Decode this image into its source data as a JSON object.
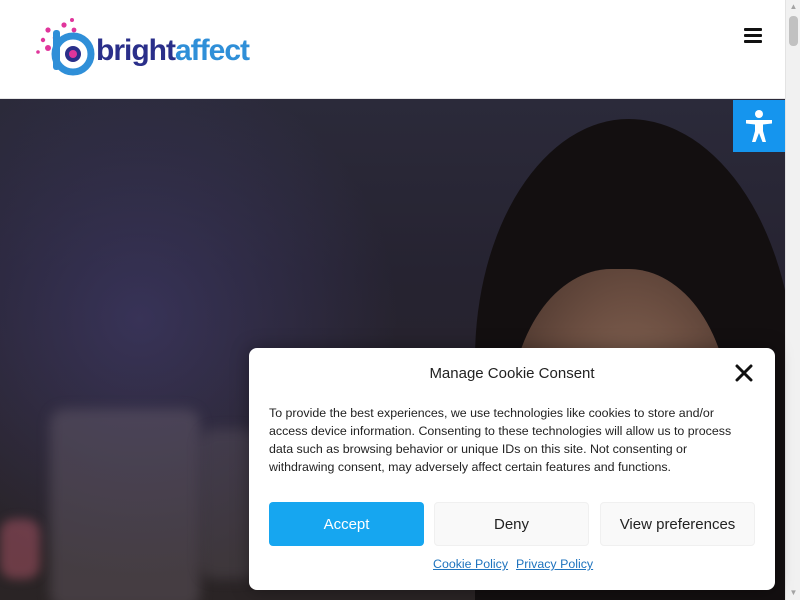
{
  "brand": {
    "logo_text_part1": "bright",
    "logo_text_part2": "affect",
    "primary_color": "#2a2f8a",
    "accent_color": "#2f8fd8",
    "pink_color": "#e0359b"
  },
  "header": {
    "menu_icon": "hamburger-menu-icon"
  },
  "accessibility": {
    "icon": "accessibility-person-icon",
    "color": "#1595ee"
  },
  "cookie_modal": {
    "title": "Manage Cookie Consent",
    "body": "To provide the best experiences, we use technologies like cookies to store and/or access device information. Consenting to these technologies will allow us to process data such as browsing behavior or unique IDs on this site. Not consenting or withdrawing consent, may adversely affect certain features and functions.",
    "buttons": {
      "accept": "Accept",
      "deny": "Deny",
      "preferences": "View preferences"
    },
    "links": {
      "cookie_policy": "Cookie Policy",
      "privacy_policy": "Privacy Policy"
    },
    "accept_color": "#16a6f0"
  }
}
